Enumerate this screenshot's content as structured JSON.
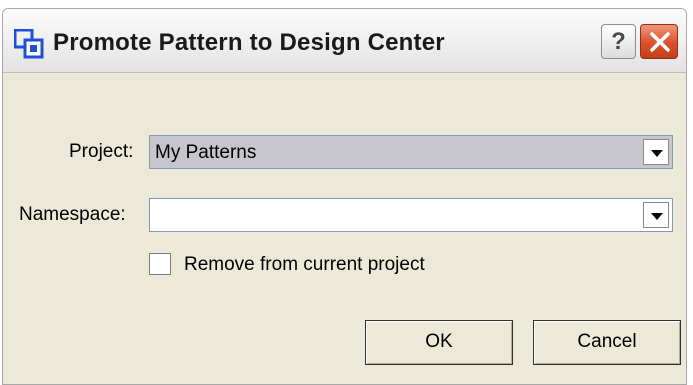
{
  "window": {
    "title": "Promote Pattern to Design Center",
    "help_label": "?"
  },
  "form": {
    "project_label": "Project:",
    "project_value": "My Patterns",
    "namespace_label": "Namespace:",
    "namespace_value": "",
    "remove_label": "Remove from current project",
    "remove_checked": false
  },
  "buttons": {
    "ok_label": "OK",
    "cancel_label": "Cancel"
  },
  "icons": {
    "app": "pattern-app-icon",
    "help": "help-icon",
    "close": "close-icon",
    "dropdown": "chevron-down-icon"
  },
  "colors": {
    "dialog_background": "#ece9d8",
    "selected_field": "#c6c6cc",
    "close_button": "#d9512c",
    "app_icon": "#1e4fd6"
  }
}
